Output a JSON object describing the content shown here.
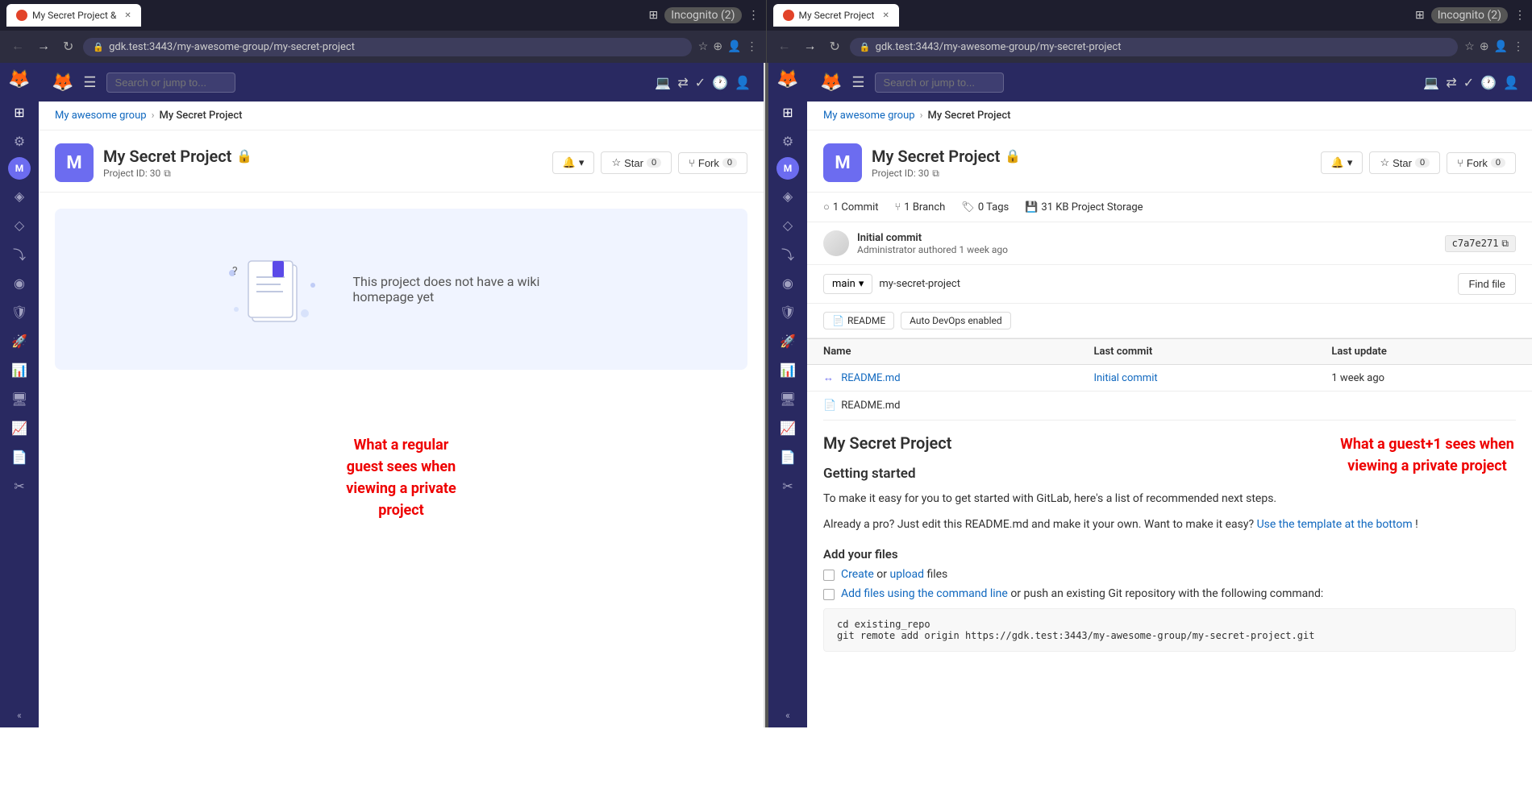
{
  "browser": {
    "left": {
      "url": "gdk.test:3443/my-awesome-group/my-secret-project",
      "tab_label": "My Secret Project &",
      "incognito": "Incognito (2)"
    },
    "right": {
      "url": "gdk.test:3443/my-awesome-group/my-secret-project",
      "tab_label": "My Secret Project",
      "incognito": "Incognito (2)"
    }
  },
  "left_pane": {
    "breadcrumb": {
      "group": "My awesome group",
      "project": "My Secret Project"
    },
    "project": {
      "name": "My Secret Project",
      "id_label": "Project ID: 30",
      "avatar_letter": "M"
    },
    "star_label": "Star",
    "star_count": "0",
    "fork_label": "Fork",
    "fork_count": "0",
    "notify_label": "🔔",
    "wiki_empty_text": "This project does not have a wiki homepage yet",
    "annotation": "What a regular\nguest sees when\nviewing a private\nproject"
  },
  "right_pane": {
    "breadcrumb": {
      "group": "My awesome group",
      "project": "My Secret Project"
    },
    "project": {
      "name": "My Secret Project",
      "id_label": "Project ID: 30",
      "avatar_letter": "M"
    },
    "star_label": "Star",
    "star_count": "0",
    "fork_label": "Fork",
    "fork_count": "0",
    "stats": {
      "commits": "1 Commit",
      "branches": "1 Branch",
      "tags": "0 Tags",
      "storage": "31 KB Project Storage"
    },
    "commit": {
      "title": "Initial commit",
      "author": "Administrator",
      "time": "authored 1 week ago",
      "hash": "c7a7e271"
    },
    "branch": {
      "name": "main",
      "path": "my-secret-project"
    },
    "find_file_label": "Find file",
    "badges": {
      "readme": "README",
      "devops": "Auto DevOps enabled"
    },
    "table": {
      "headers": [
        "Name",
        "Last commit",
        "Last update"
      ],
      "rows": [
        {
          "name": "README.md",
          "last_commit": "Initial commit",
          "last_update": "1 week ago"
        }
      ]
    },
    "readme": {
      "filename": "README.md",
      "title": "My Secret Project",
      "getting_started": "Getting started",
      "para1": "To make it easy for you to get started with GitLab, here's a list of recommended next steps.",
      "para2": "Already a pro? Just edit this README.md and make it your own. Want to make it easy?",
      "link_text": "Use the template at the bottom",
      "link_suffix": "!",
      "add_files": "Add your files",
      "create_link": "Create",
      "or_text": "or",
      "upload_link": "upload",
      "files_text": "files",
      "cmdline_link": "Add files using the command line",
      "cmdline_suffix": "or push an existing Git repository with the following command:",
      "code_block": "cd existing_repo\ngit remote add origin https://gdk.test:3443/my-awesome-group/my-secret-project.git"
    },
    "annotation": "What a guest+1\nsees when viewing\na private project"
  }
}
